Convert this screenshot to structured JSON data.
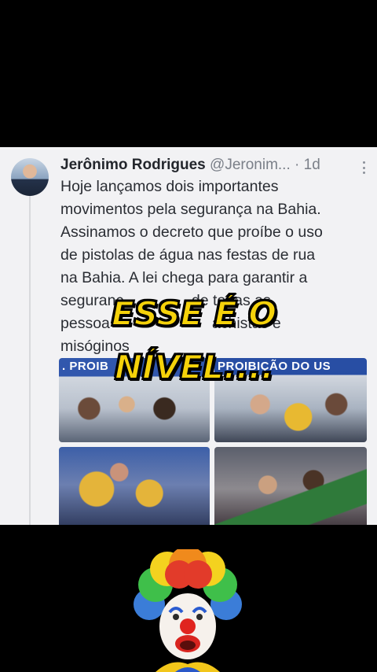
{
  "tweet": {
    "author_name": "Jerônimo Rodrigues",
    "author_handle": "@Jeronim...",
    "separator": "·",
    "timestamp": "1d",
    "text_lines": [
      "Hoje lançamos dois importantes",
      "movimentos pela segurança na Bahia.",
      "Assinamos o decreto que proíbe o uso",
      "de pistolas de água nas festas de rua",
      "na Bahia. A lei chega para garantir a",
      "seguranç                de todas as",
      "pessoa                        achistas e",
      "misóginos"
    ],
    "photo_banner_1": ". PROIB",
    "photo_banner_2": "PROIBIÇÃO DO US"
  },
  "overlay": {
    "line1": "ESSE É O",
    "line2": "NÍVEL...."
  },
  "colors": {
    "overlay_fill": "#f5d20a",
    "background": "#000000",
    "card": "#f2f2f4"
  }
}
